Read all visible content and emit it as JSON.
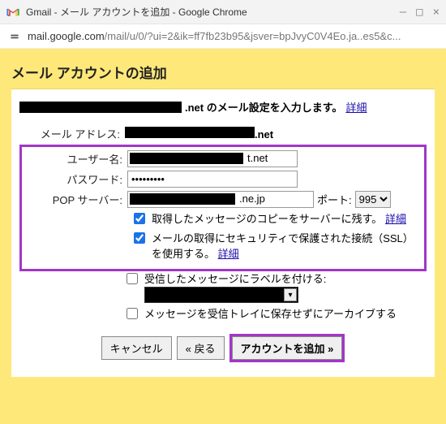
{
  "window": {
    "title": "Gmail - メール アカウントを追加 - Google Chrome",
    "min": "—",
    "max": "□",
    "close": "×"
  },
  "address": {
    "host": "mail.google.com",
    "path": "/mail/u/0/?ui=2&ik=ff7fb23b95&jsver=bpJvyC0V4Eo.ja..es5&c..."
  },
  "page": {
    "heading": "メール アカウントの追加",
    "intro_suffix": ".net のメール設定を入力します。",
    "intro_link": "詳細",
    "labels": {
      "email": "メール アドレス:",
      "user": "ユーザー名:",
      "password": "パスワード:",
      "pop": "POP サーバー:",
      "port": "ポート:"
    },
    "values": {
      "email_suffix": ".net",
      "user_suffix": "t.net",
      "password": "•••••••••",
      "pop_suffix": ".ne.jp",
      "port": "995"
    },
    "checks": {
      "leave_copy": "取得したメッセージのコピーをサーバーに残す。",
      "leave_copy_link": "詳細",
      "ssl": "メールの取得にセキュリティで保護された接続（SSL）を使用する。",
      "ssl_link": "詳細",
      "label_msg": "受信したメッセージにラベルを付ける:",
      "archive": "メッセージを受信トレイに保存せずにアーカイブする"
    },
    "buttons": {
      "cancel": "キャンセル",
      "back": "« 戻る",
      "add": "アカウントを追加 »"
    }
  }
}
